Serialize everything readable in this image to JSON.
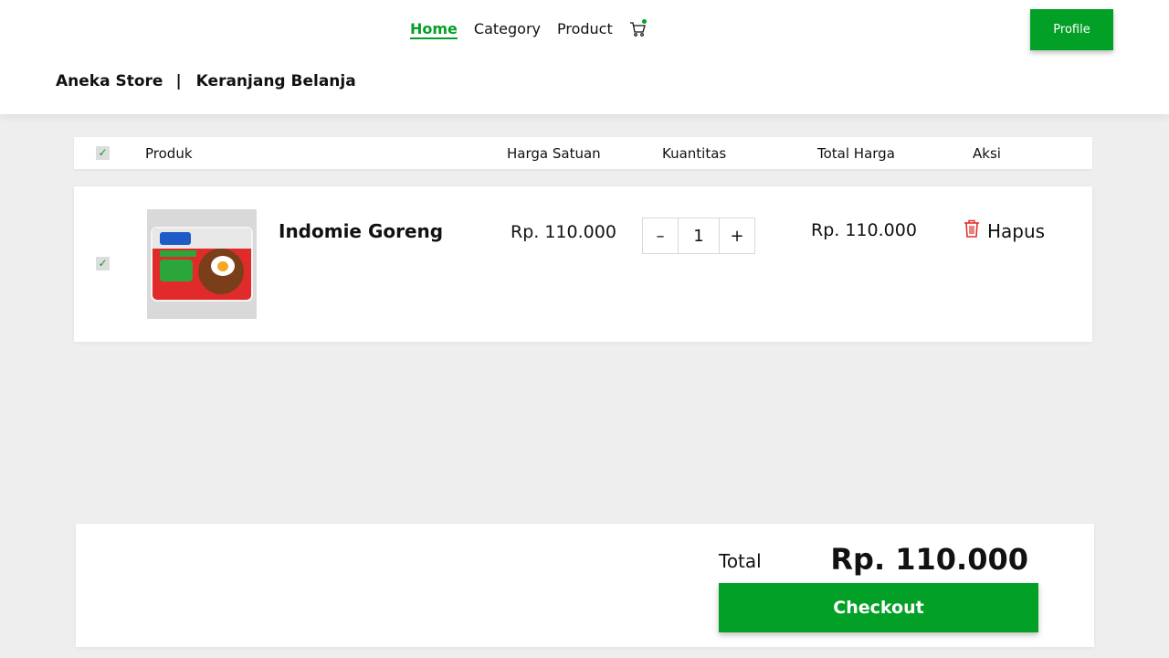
{
  "nav": {
    "items": [
      {
        "label": "Home",
        "active": true
      },
      {
        "label": "Category",
        "active": false
      },
      {
        "label": "Product",
        "active": false
      }
    ],
    "cart_icon": "cart-icon",
    "profile_label": "Profile"
  },
  "breadcrumb": {
    "store": "Aneka Store",
    "separator": "|",
    "page": "Keranjang Belanja"
  },
  "table": {
    "headers": {
      "product": "Produk",
      "unit_price": "Harga Satuan",
      "quantity": "Kuantitas",
      "total_price": "Total Harga",
      "action": "Aksi"
    },
    "select_all_checked": true,
    "rows": [
      {
        "checked": true,
        "name": "Indomie Goreng",
        "unit_price": "Rp. 110.000",
        "quantity": "1",
        "minus_label": "–",
        "plus_label": "+",
        "total": "Rp. 110.000",
        "action_label": "Hapus",
        "action_icon": "trash-icon"
      }
    ]
  },
  "summary": {
    "total_label": "Total",
    "total_value": "Rp. 110.000",
    "checkout_label": "Checkout"
  },
  "colors": {
    "accent": "#03a027",
    "danger": "#e03131",
    "background": "#eeeeee"
  }
}
